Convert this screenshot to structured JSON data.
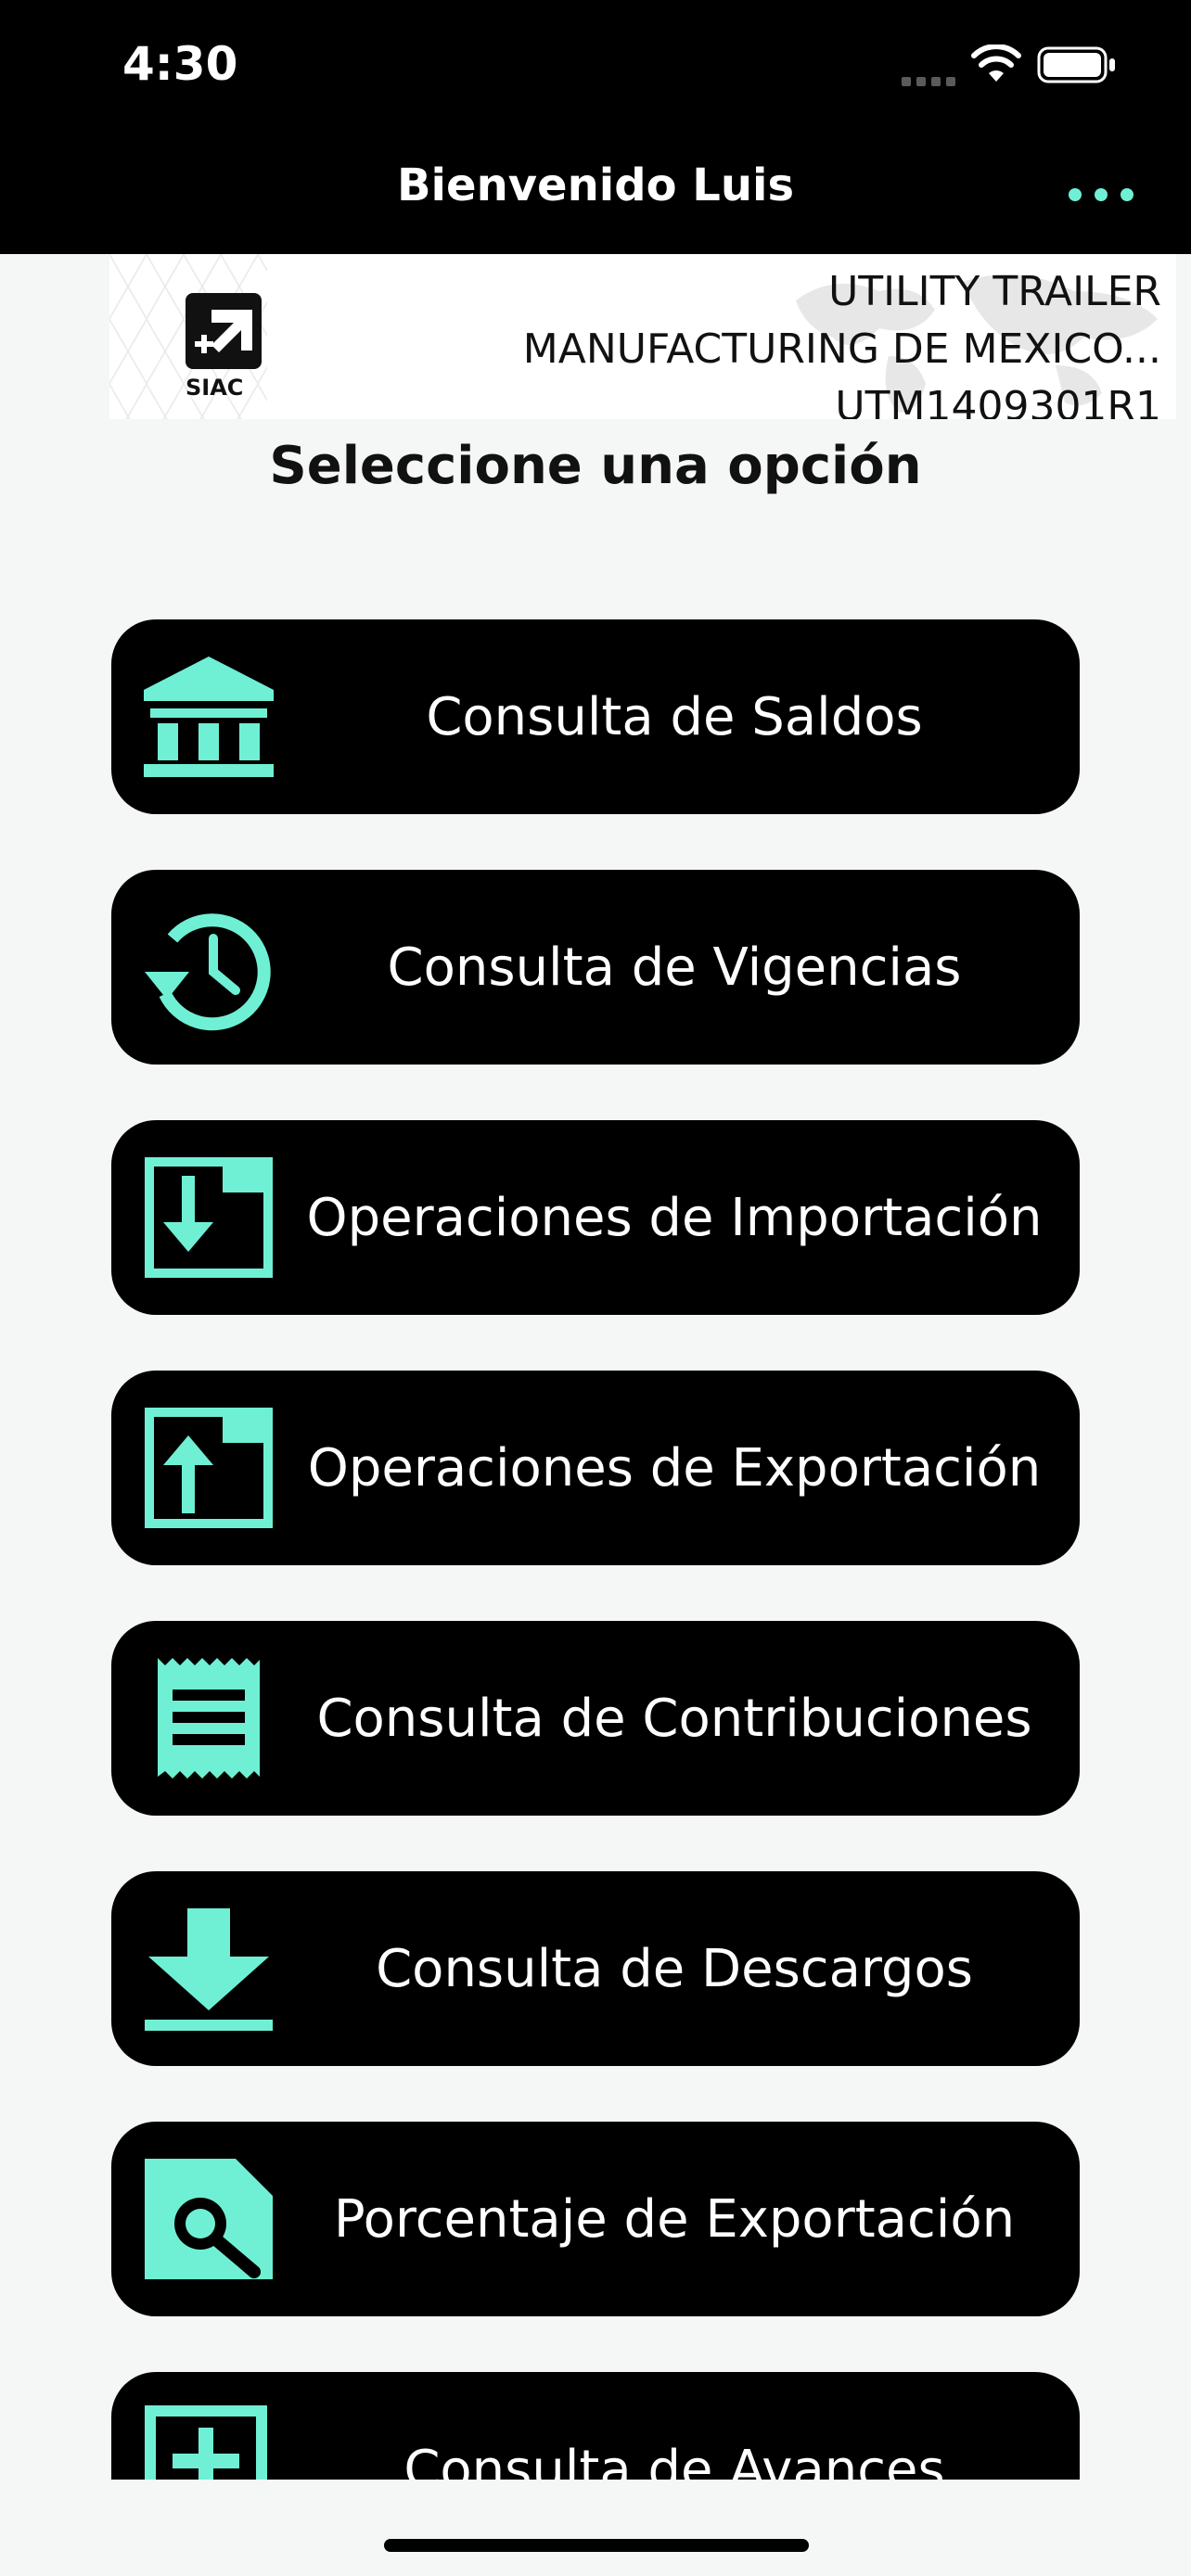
{
  "status": {
    "time": "4:30"
  },
  "nav": {
    "title": "Bienvenido Luis",
    "menu_icon": "more-horizontal-icon"
  },
  "company": {
    "logo_text": "SIAC",
    "name_line1": "UTILITY TRAILER",
    "name_line2": "MANUFACTURING DE MEXICO...",
    "rfc": "UTM1409301R1"
  },
  "prompt": "Seleccione una opción",
  "menu": [
    {
      "label": "Consulta de Saldos",
      "icon": "bank-icon"
    },
    {
      "label": "Consulta de Vigencias",
      "icon": "history-icon"
    },
    {
      "label": "Operaciones de Importación",
      "icon": "import-tray-icon"
    },
    {
      "label": "Operaciones de Exportación",
      "icon": "export-tray-icon"
    },
    {
      "label": "Consulta de Contribuciones",
      "icon": "receipt-icon"
    },
    {
      "label": "Consulta de Descargos",
      "icon": "download-icon"
    },
    {
      "label": "Porcentaje de Exportación",
      "icon": "file-search-icon"
    },
    {
      "label": "Consulta de Avances",
      "icon": "add-box-icon"
    }
  ],
  "colors": {
    "accent": "#6ff0d4",
    "button_bg": "#000000",
    "page_bg": "#f5f7f6"
  }
}
